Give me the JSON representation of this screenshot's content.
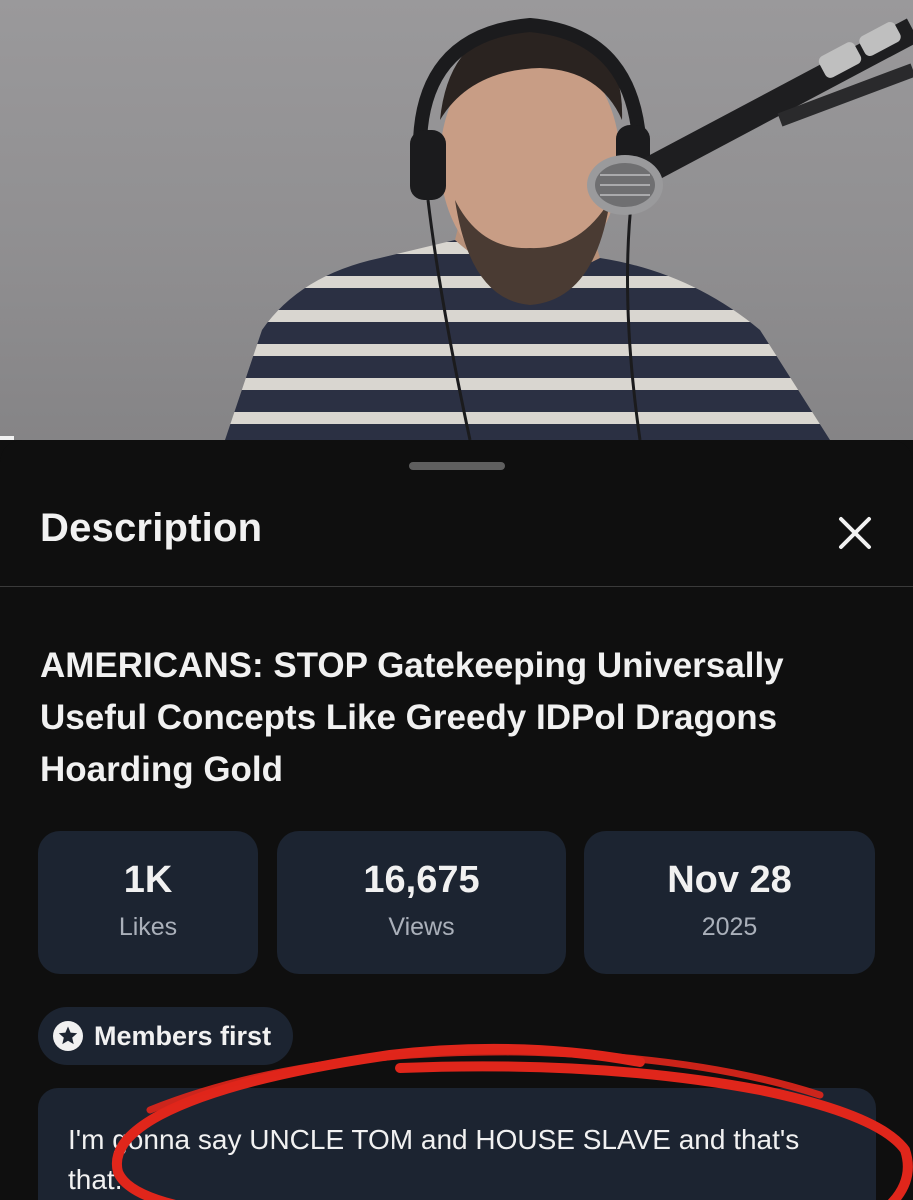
{
  "sheet": {
    "title": "Description",
    "close_icon": "close-icon"
  },
  "video": {
    "title": "AMERICANS: STOP Gatekeeping Universally Useful Concepts Like Greedy IDPol Dragons Hoarding Gold"
  },
  "stats": [
    {
      "value": "1K",
      "label": "Likes"
    },
    {
      "value": "16,675",
      "label": "Views"
    },
    {
      "value": "Nov 28",
      "label": "2025"
    }
  ],
  "members_chip": {
    "label": "Members first",
    "icon": "star-badge-icon"
  },
  "description": {
    "text": "I'm gonna say UNCLE TOM and HOUSE SLAVE and that's that."
  },
  "colors": {
    "background": "#0f0f0f",
    "card": "#1c2431",
    "annotation": "#e0261b"
  }
}
